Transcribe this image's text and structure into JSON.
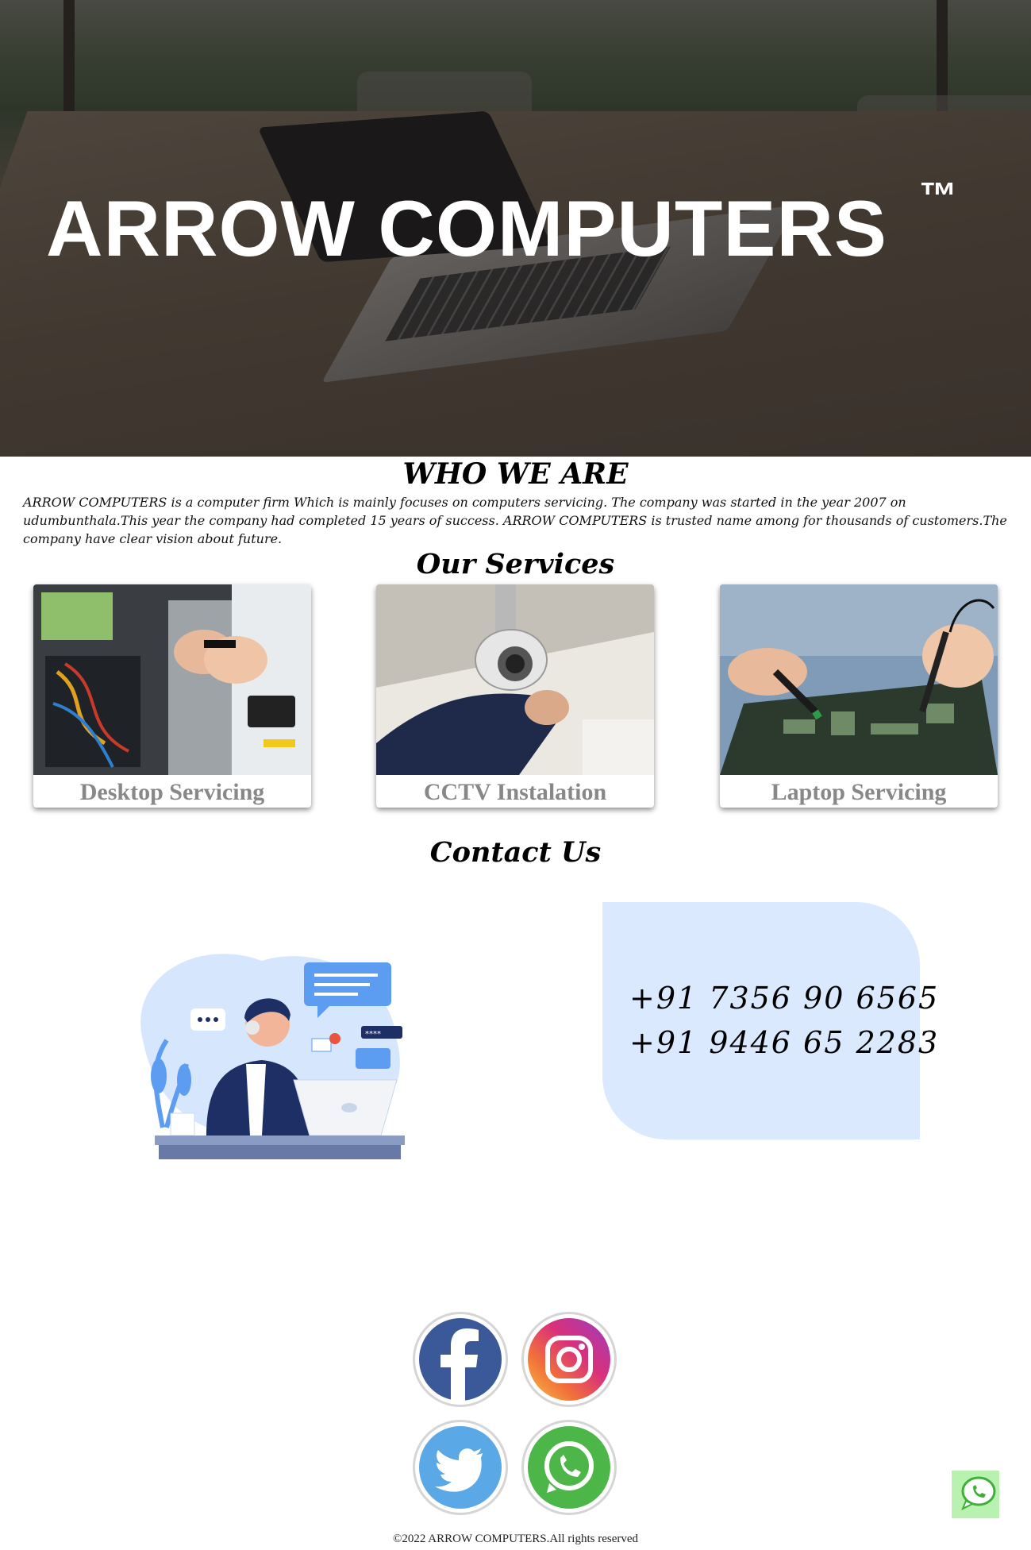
{
  "hero": {
    "title": "ARROW COMPUTERS",
    "trademark": "™"
  },
  "about": {
    "heading": "WHO WE ARE",
    "text": "ARROW COMPUTERS is a computer firm Which is mainly focuses on computers servicing. The company was started in the year 2007 on udumbunthala.This year the company had completed 15 years of success. ARROW COMPUTERS is trusted name among for thousands of customers.The company have clear vision about future."
  },
  "services": {
    "heading": "Our Services",
    "items": [
      {
        "label": "Desktop Servicing"
      },
      {
        "label": "CCTV Instalation"
      },
      {
        "label": "Laptop Servicing"
      }
    ]
  },
  "contact": {
    "heading": "Contact Us",
    "phones": [
      "+91 7356 90 6565",
      "+91 9446 65 2283"
    ]
  },
  "social": {
    "icons": [
      "facebook-icon",
      "instagram-icon",
      "twitter-icon",
      "whatsapp-icon"
    ]
  },
  "footer": {
    "text": "©2022 ARROW COMPUTERS.All rights reserved"
  },
  "colors": {
    "contact_box": "#dae9fe",
    "caption": "#888888",
    "facebook": "#3b5998",
    "twitter": "#5aa9e6",
    "whatsapp": "#4cb748"
  }
}
